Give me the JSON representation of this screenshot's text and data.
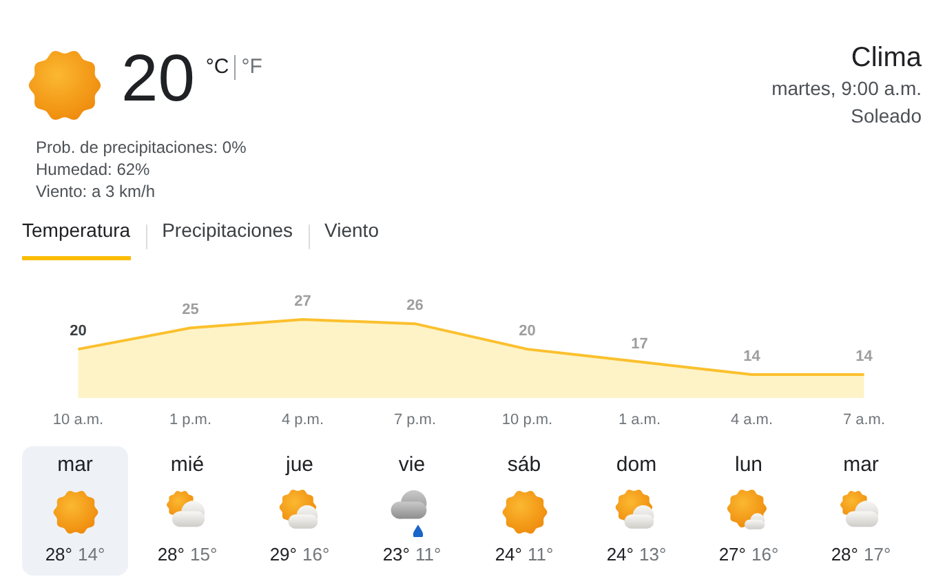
{
  "current": {
    "kind": "sunny",
    "temperature": "20",
    "units": [
      {
        "label": "°C",
        "selected": true
      },
      {
        "label": "°F",
        "selected": false
      }
    ],
    "details": [
      "Prob. de precipitaciones: 0%",
      "Humedad: 62%",
      "Viento: a 3 km/h"
    ]
  },
  "header": {
    "title": "Clima",
    "datetime": "martes, 9:00 a.m.",
    "condition": "Soleado"
  },
  "tabs": [
    {
      "label": "Temperatura",
      "selected": true
    },
    {
      "label": "Precipitaciones",
      "selected": false
    },
    {
      "label": "Viento",
      "selected": false
    }
  ],
  "chart_data": {
    "type": "area",
    "categories": [
      "10 a.m.",
      "1 p.m.",
      "4 p.m.",
      "7 p.m.",
      "10 p.m.",
      "1 a.m.",
      "4 a.m.",
      "7 a.m."
    ],
    "series": [
      {
        "color": "#fbc02d",
        "values": [
          20,
          25,
          27,
          26,
          20,
          17,
          14,
          14
        ]
      }
    ],
    "data_labels": true
  },
  "days": [
    {
      "day": "mar",
      "kind": "sunny",
      "high": "28°",
      "low": "14°",
      "selected": true
    },
    {
      "day": "mié",
      "kind": "cloudy",
      "high": "28°",
      "low": "15°",
      "selected": false
    },
    {
      "day": "jue",
      "kind": "partly",
      "high": "29°",
      "low": "16°",
      "selected": false
    },
    {
      "day": "vie",
      "kind": "rain",
      "high": "23°",
      "low": "11°",
      "selected": false
    },
    {
      "day": "sáb",
      "kind": "sunny",
      "high": "24°",
      "low": "11°",
      "selected": false
    },
    {
      "day": "dom",
      "kind": "partly",
      "high": "24°",
      "low": "13°",
      "selected": false
    },
    {
      "day": "lun",
      "kind": "fair",
      "high": "27°",
      "low": "16°",
      "selected": false
    },
    {
      "day": "mar",
      "kind": "cloudy",
      "high": "28°",
      "low": "17°",
      "selected": false
    }
  ]
}
